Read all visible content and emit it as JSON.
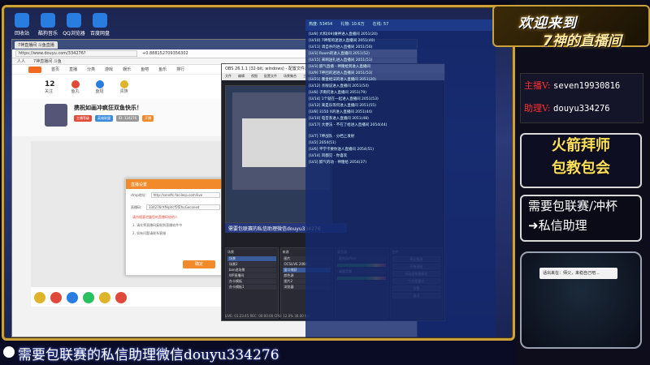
{
  "desktop": {
    "icons": [
      {
        "label": "回收站",
        "icon": "recycle-bin-icon"
      },
      {
        "label": "酷狗音乐",
        "icon": "kugou-icon"
      },
      {
        "label": "QQ浏览器",
        "icon": "qq-browser-icon"
      },
      {
        "label": "百度网盘",
        "icon": "baidu-netdisk-icon"
      }
    ]
  },
  "browser": {
    "tab_label": "7神直播间 斗鱼直播",
    "url": "https://www.douyu.com/334276?",
    "url_extra": "+0.888152709356302",
    "bookmarks": [
      "人人",
      "7神直播间 斗鱼"
    ],
    "nav": [
      "首页",
      "直播",
      "分类",
      "游戏",
      "娱乐",
      "鱼吧",
      "鱼乐",
      "排行"
    ],
    "stats": [
      {
        "n": "12",
        "label": "关注"
      },
      {
        "n": "",
        "label": "鱼丸"
      },
      {
        "n": "",
        "label": "鱼翅"
      },
      {
        "n": "",
        "label": "贵族"
      }
    ],
    "room_title": "携祝如画冲疯狂双鱼快乐！",
    "room_tags": [
      "主播等级",
      "英雄联盟",
      "ID: 334276",
      "开播"
    ],
    "modal": {
      "title": "直播设置",
      "rtmp_label": "rtmp地址：",
      "rtmp_value": "http://sendfc.facilecp.com/live",
      "code_label": "直播码：",
      "code_value": "334276rXfHpVcf5fZhuGeconed",
      "tip": "请勿随意泄露您的直播码给他人",
      "notes": [
        "1. 请先将直播码复制到直播软件中",
        "2. 如有问题请联系客服"
      ],
      "ok_label": "确定"
    }
  },
  "obs": {
    "title": "OBS 26.1.1 (32-bit, windows) - 配置文件:",
    "menu": [
      "文件",
      "编辑",
      "视图",
      "配置文件",
      "场景集合",
      "工具",
      "帮助"
    ],
    "caption": "需要包联赛的私信助理微信douyu334276",
    "panels": {
      "scenes": {
        "header": "场景",
        "items": [
          "场景",
          "场景2",
          "ban进场景",
          "WP直播间",
          "办卡模板",
          "办卡模板1"
        ]
      },
      "sources": {
        "header": "来源",
        "items": [
          "图片",
          "OCSLIVE 2068",
          "窗口捕获",
          "颜色源",
          "图片2",
          "浏览器"
        ]
      },
      "mixer": {
        "header": "混音器",
        "items": [
          "麦克风/Aux",
          "桌面音频"
        ]
      },
      "controls": {
        "header": "控件",
        "items": [
          "停止推流",
          "开始录制",
          "启动虚拟摄像机",
          "工作室模式",
          "设置",
          "退出"
        ]
      }
    },
    "status": "LIVE: 01:23:45  REC: 00:00:00  CPU: 12.0%  30.00 fps"
  },
  "chat": {
    "header_items": [
      "热度: 53454",
      "礼物: 10.6万",
      "在线: 57"
    ],
    "messages": [
      "[LV8] 大和[69]做神进入直播间 2051(20)",
      "[LV10] 7神帮的迷进入直播间 2051(40)",
      "[LV11] 调自杀的进入直播间 2051(50)",
      "[LV3] Room的进入直播间 2051(52)",
      "[LV15] 来啊送礼进入直播间 2051(51)",
      "[LV3] 醉气直播 - 神隆给到进入直播间",
      "[LV9] 7神团的迷进入直播间 2051(53)",
      "[LV21] 重金给法的进入直播间 2051(20)",
      "[LV12] 亲眼说进入直播间 2051(54)",
      "[LV8] 子嘶何进入直播间 2051(79)",
      "[LV14] 1个就在一起进入直播间 2051(53)",
      "[LV12] 来是乐等何进入直播间 2051(55)",
      "[LV8] 3150 X的进入直播间 2051(44)",
      "[LV10] 电音系进入直播间 2051(48)",
      "[LV17] 大便法 - 不在了给进入直播间 2054(44)"
    ],
    "gift_messages": [
      "[LV7] 7神战队 - 分档上发射",
      "[LV2] 2054(51)",
      "[LV6] 平学卡要你送人直播间 2054(51)",
      "[LV14] 风都见 - 你喜欢",
      "[LV3] 醉气的动 - 神隆给 2054(37)"
    ]
  },
  "right_panel": {
    "welcome_line1": "欢迎来到",
    "welcome_line2": "7神的直播间",
    "anchor_label": "主播V:",
    "anchor_value": "seven19930816",
    "assistant_label": "助理V:",
    "assistant_value": "douyu334276",
    "promo_a": [
      "火箭拜师",
      "包教包会"
    ],
    "promo_b": [
      "需要包联赛/冲杯",
      "➜私信助理"
    ],
    "notice": "话出来在：师父，来稳自己吧..."
  },
  "ticker": {
    "text": "需要包联赛的私信助理微信douyu334276"
  },
  "colors": {
    "frame_gold": "#c9a23a",
    "chat_overlay": "#14286e",
    "label_red": "#ff3030",
    "promo_yellow": "#ffe05a"
  }
}
